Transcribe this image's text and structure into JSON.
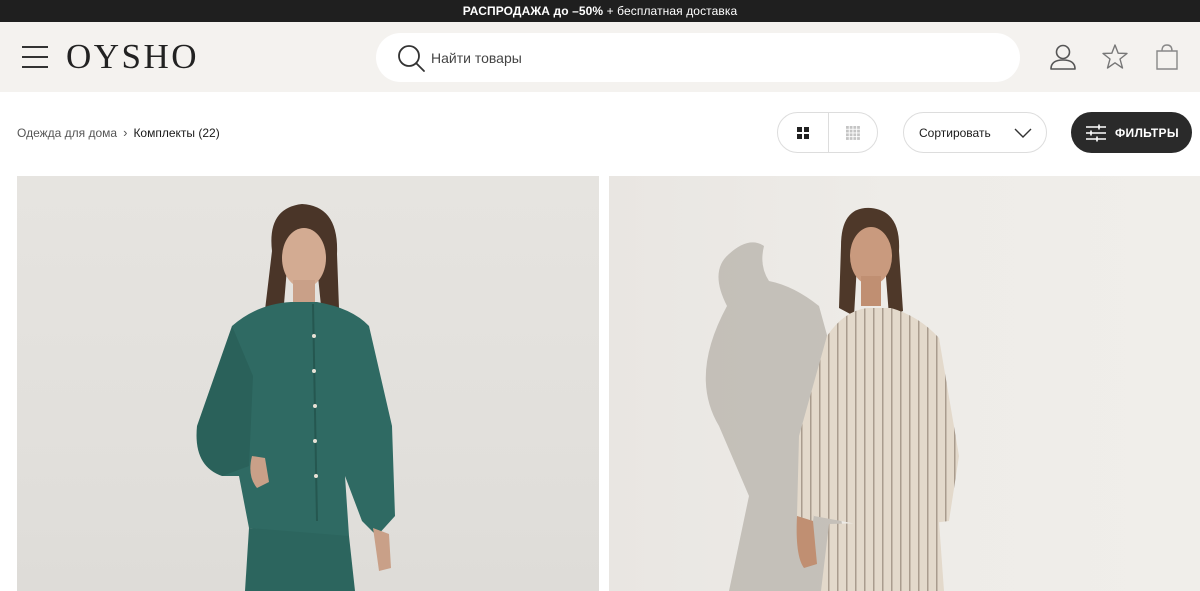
{
  "promo": {
    "bold": "РАСПРОДАЖА до –50%",
    "rest": " + бесплатная доставка"
  },
  "header": {
    "logo": "OYSHO",
    "search_placeholder": "Найти товары",
    "icons": [
      "menu-icon",
      "search-icon",
      "user-icon",
      "star-icon",
      "bag-icon"
    ]
  },
  "breadcrumb": {
    "parent": "Одежда для дома",
    "current": "Комплекты (22)"
  },
  "toolbar": {
    "view_options": [
      "grid-2-icon",
      "grid-4-icon"
    ],
    "sort_label": "Сортировать",
    "filters_label": "ФИЛЬТРЫ"
  },
  "products": [
    {
      "image": "model in teal pajama set",
      "color": "#2f6a63"
    },
    {
      "image": "model in beige striped pajama set",
      "color": "#e3d9cb"
    }
  ],
  "colors": {
    "promo_bg": "#1f1f1f",
    "header_bg": "#f4f2ef",
    "filter_btn": "#2a2a2a"
  }
}
